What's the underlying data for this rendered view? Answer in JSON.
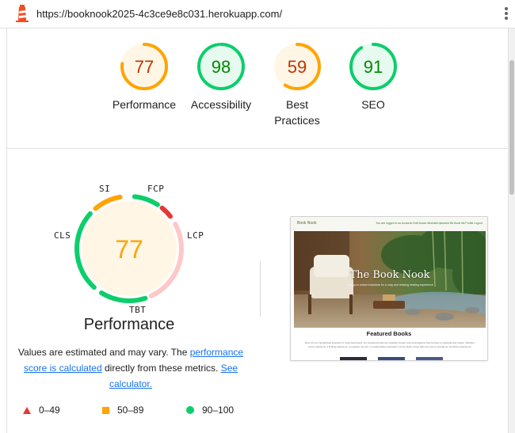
{
  "browser": {
    "url": "https://booknook2025-4c3ce9e8c031.herokuapp.com/",
    "logo_icon": "lighthouse-icon",
    "menu_icon": "kebab-menu-icon"
  },
  "summary": [
    {
      "label": "Performance",
      "score": 77,
      "band": "average"
    },
    {
      "label": "Accessibility",
      "score": 98,
      "band": "pass"
    },
    {
      "label": "Best Practices",
      "score": 59,
      "band": "average"
    },
    {
      "label": "SEO",
      "score": 91,
      "band": "pass"
    }
  ],
  "performance": {
    "score": 77,
    "title": "Performance",
    "metrics": [
      "SI",
      "FCP",
      "LCP",
      "TBT",
      "CLS"
    ],
    "note": {
      "prefix": "Values are estimated and may vary. The ",
      "link1": "performance score is calculated",
      "middle": " directly from these metrics. ",
      "link2": "See calculator."
    }
  },
  "legend": [
    {
      "range": "0–49",
      "shape": "triangle",
      "color": "#e53935"
    },
    {
      "range": "50–89",
      "shape": "square",
      "color": "#ffa400"
    },
    {
      "range": "90–100",
      "shape": "circle",
      "color": "#0cce6b"
    }
  ],
  "screenshot": {
    "brand": "Book Nook",
    "nav_links": "You are logged in as bookerlo   Edit Books   Wishlist/Uploaded Bk   Book list   Profile   Logout",
    "hero_title": "The Book Nook",
    "hero_subtitle": "Your go-to online bookstore for a cozy and relaxing reading experience",
    "section_title": "Featured Books",
    "body_text": "Dive into our handpicked selection of must-read books. Our featured books are carefully chosen recommendations that promise to captivate and inspire. Whether you're looking for a thrilling adventure, a poignant memoir, or a fascinating exploration of new ideas, these titles are sure to provide an enriching experience."
  },
  "colors": {
    "pass": "#0cce6b",
    "pass_text": "#008800",
    "pass_bg": "#e6faef",
    "average": "#ffa400",
    "average_text": "#c33300",
    "average_bg": "#fff6e5",
    "fail": "#e53935",
    "link": "#1a73e8"
  }
}
